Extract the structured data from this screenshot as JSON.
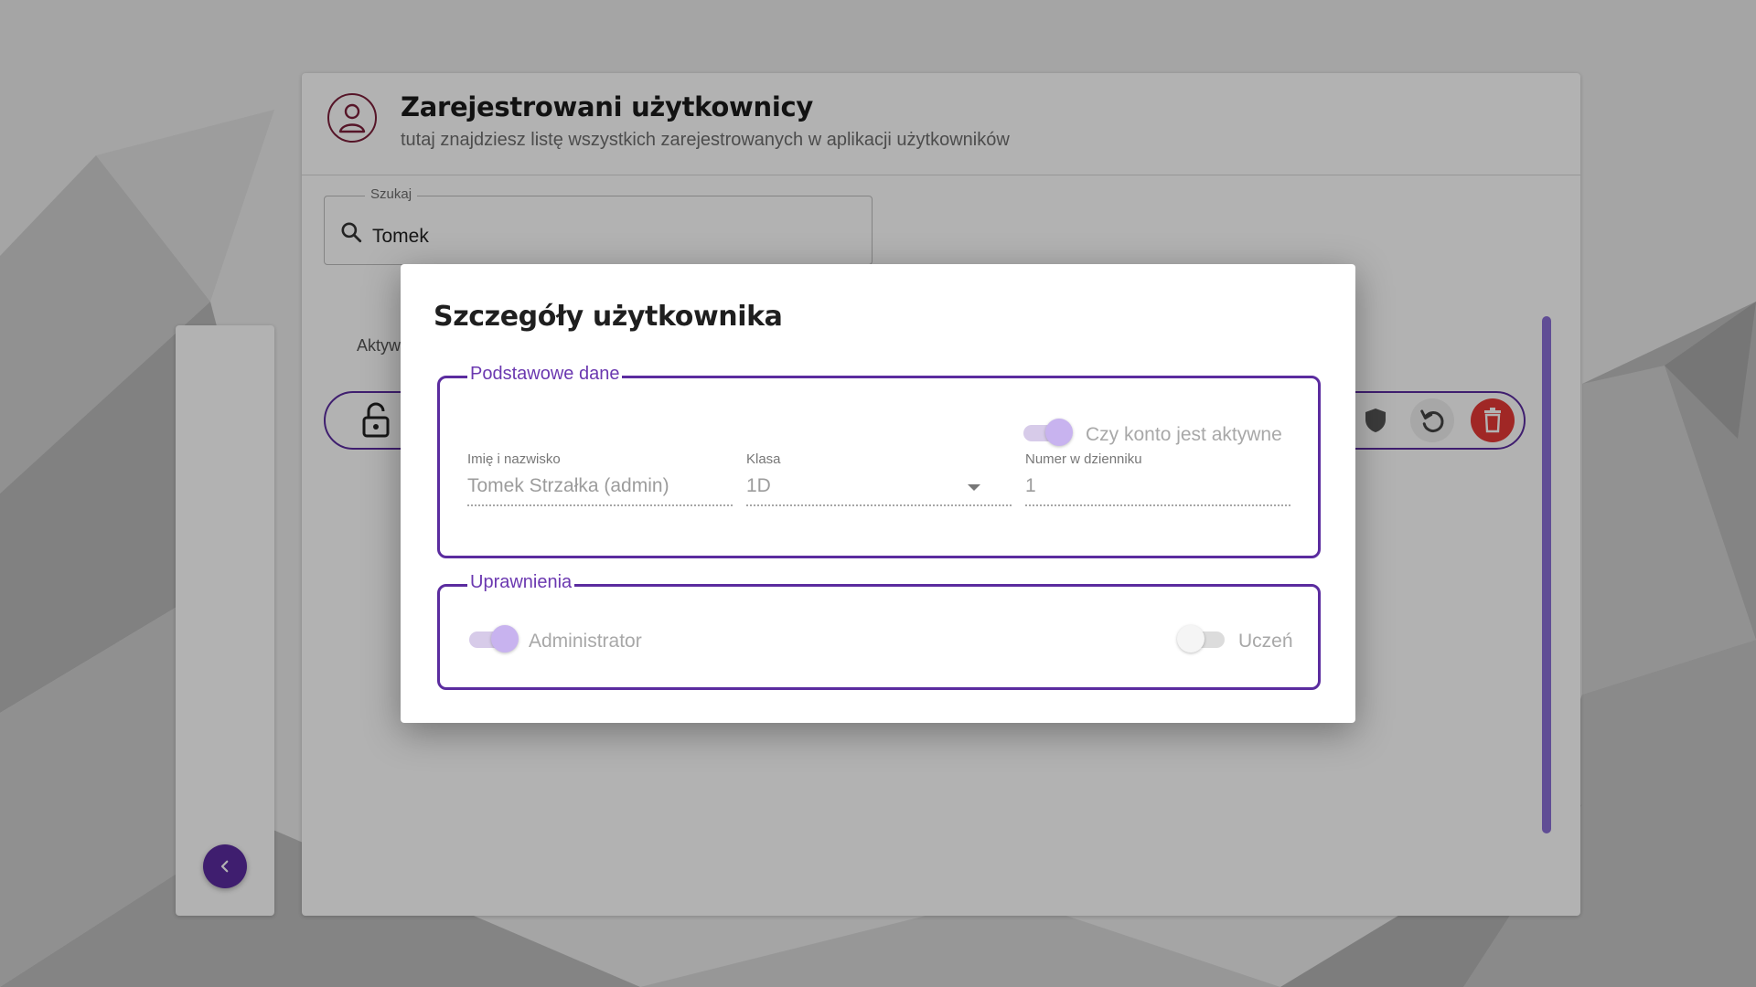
{
  "page": {
    "title": "Zarejestrowani użytkownicy",
    "subtitle": "tutaj znajdziesz listę wszystkich zarejestrowanych w aplikacji użytkowników"
  },
  "search": {
    "label": "Szukaj",
    "value": "Tomek"
  },
  "list": {
    "column_label_partial": "Aktyw"
  },
  "dialog": {
    "title": "Szczegóły użytkownika",
    "basic": {
      "legend": "Podstawowe dane",
      "active_toggle_label": "Czy konto jest aktywne",
      "active": true,
      "name_label": "Imię i nazwisko",
      "name_value": "Tomek Strzałka (admin)",
      "class_label": "Klasa",
      "class_value": "1D",
      "number_label": "Numer w dzienniku",
      "number_value": "1"
    },
    "permissions": {
      "legend": "Uprawnienia",
      "admin_label": "Administrator",
      "admin": true,
      "student_label": "Uczeń",
      "student": false
    }
  },
  "colors": {
    "accent": "#5b2c9f",
    "legend_text": "#6b38b0",
    "danger": "#e53935"
  },
  "icons": [
    "person-circle-icon",
    "search-icon",
    "lock-open-icon",
    "shield-icon",
    "undo-icon",
    "trash-icon",
    "chevron-left-icon",
    "caret-down-icon"
  ]
}
